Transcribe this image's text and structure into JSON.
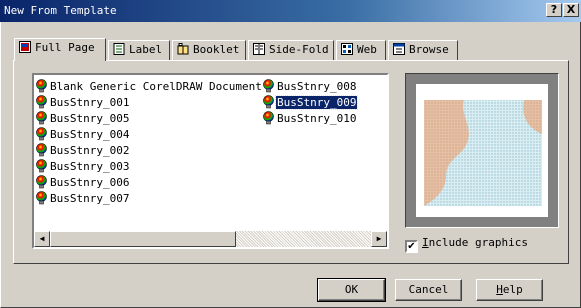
{
  "window": {
    "title": "New From Template",
    "help_button": "?",
    "close_button": "X"
  },
  "tabs": [
    {
      "label": "Full Page",
      "icon": "full-page-icon",
      "active": true
    },
    {
      "label": "Label",
      "icon": "label-icon",
      "active": false
    },
    {
      "label": "Booklet",
      "icon": "booklet-icon",
      "active": false
    },
    {
      "label": "Side-Fold",
      "icon": "side-fold-icon",
      "active": false
    },
    {
      "label": "Web",
      "icon": "web-icon",
      "active": false
    },
    {
      "label": "Browse",
      "icon": "browse-icon",
      "active": false
    }
  ],
  "templates": {
    "column1": [
      "Blank Generic CorelDRAW Document",
      "BusStnry_001",
      "BusStnry_005",
      "BusStnry_004",
      "BusStnry_002",
      "BusStnry_003",
      "BusStnry_006",
      "BusStnry_007"
    ],
    "column2": [
      "BusStnry_008",
      "BusStnry_009",
      "BusStnry_010"
    ],
    "selected": "BusStnry_009",
    "item_icon": "template-bulb-icon"
  },
  "preview": {
    "colors": {
      "shape": "#e3b99a",
      "texture": "#c9e3ea",
      "frame": "#808080"
    }
  },
  "options": {
    "include_graphics_label_prefix": "I",
    "include_graphics_label_rest": "nclude graphics",
    "include_graphics_checked": true,
    "check_mark": "✔"
  },
  "buttons": {
    "ok": "OK",
    "cancel": "Cancel",
    "help_prefix": "H",
    "help_rest": "elp"
  }
}
